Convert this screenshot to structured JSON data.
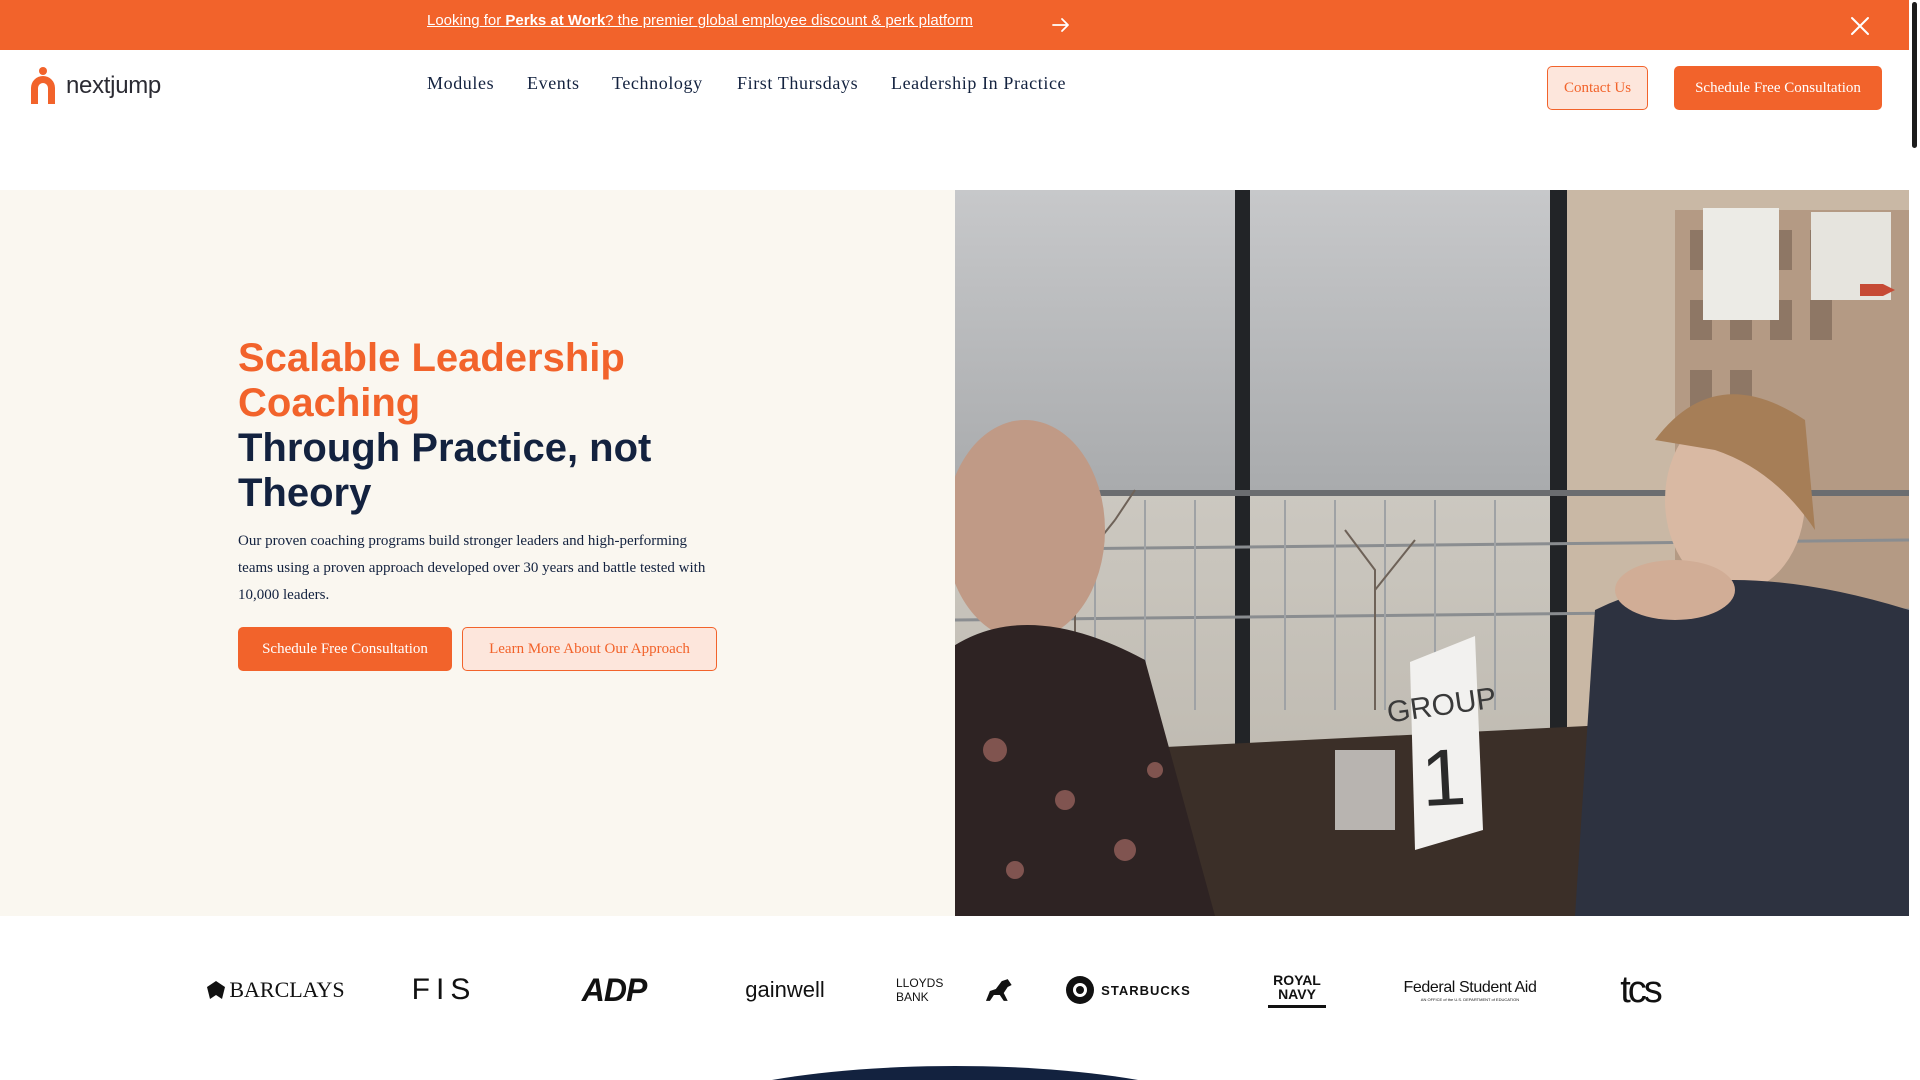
{
  "announcement": {
    "prefix": "Looking for ",
    "bold": "Perks at Work",
    "suffix": "? the premier global employee discount & perk platform",
    "arrow_icon": "arrow-right-icon",
    "close_icon": "close-icon"
  },
  "brand": {
    "name": "nextjump",
    "accent": "#f2632b",
    "navy": "#13223f"
  },
  "nav": {
    "items": [
      "Modules",
      "Events",
      "Technology",
      "First Thursdays",
      "Leadership In Practice"
    ]
  },
  "header_buttons": {
    "contact": "Contact Us",
    "schedule": "Schedule Free Consultation"
  },
  "hero": {
    "title_accent": "Scalable Leadership Coaching",
    "title_dark": "Through Practice, not Theory",
    "description": "Our proven coaching programs build stronger leaders and high-performing teams using a proven approach developed over 30 years and battle tested with 10,000 leaders.",
    "primary_button": "Schedule Free Consultation",
    "secondary_button": "Learn More About Our Approach",
    "photo_sign_line1": "GROUP",
    "photo_sign_line2": "1"
  },
  "clients": {
    "barclays": "BARCLAYS",
    "fis": "FIS",
    "adp": "ADP",
    "gainwell": "gainwell",
    "lloyds": "LLOYDS BANK",
    "starbucks": "STARBUCKS",
    "royal_navy_1": "ROYAL",
    "royal_navy_2": "NAVY",
    "fsa": "Federal Student Aid",
    "fsa_sub": "AN OFFICE of the U.S. DEPARTMENT of EDUCATION",
    "tcs": "tcs"
  }
}
